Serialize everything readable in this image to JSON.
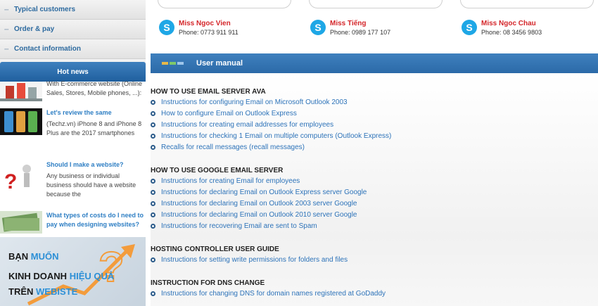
{
  "sidebar": {
    "nav": [
      {
        "label": "Typical customers"
      },
      {
        "label": "Order & pay"
      },
      {
        "label": "Contact information"
      }
    ],
    "hot_news": {
      "header": "Hot news",
      "items": [
        {
          "title": "",
          "text": "With E-commerce website (Online Sales, Stores, Mobile phones, ...):"
        },
        {
          "title": "Let's review the same",
          "text": "(Techz.vn) iPhone 8 and iPhone 8 Plus are the 2017 smartphones"
        },
        {
          "title": "Should I make a website?",
          "text": "Any business or individual business should have a website because the"
        },
        {
          "title": "What types of costs do I need to pay when designing websites?",
          "text": ""
        }
      ]
    },
    "banner": {
      "line1_a": "BẠN",
      "line1_b": "MUỐN",
      "line2_a": "KINH DOANH",
      "line2_b": "HIỆU QUẢ",
      "line3_a": "TRÊN",
      "line3_b": "WEBISTE",
      "mark": "?"
    }
  },
  "contacts": [
    {
      "name": "Miss Ngoc Vien",
      "phone": "Phone: 0773 911 911"
    },
    {
      "name": "Miss Tiếng",
      "phone": "Phone: 0989 177 107"
    },
    {
      "name": "Miss Ngoc Chau",
      "phone": "Phone: 08 3456 9803"
    }
  ],
  "manual": {
    "title": "User manual",
    "sections": [
      {
        "heading": "HOW TO USE EMAIL SERVER AVA",
        "links": [
          "Instructions for configuring Email on Microsoft Outlook 2003",
          "How to configure Email on Outlook Express",
          "Instructions for creating email addresses for employees",
          "Instructions for checking 1 Email on multiple computers (Outlook Express)",
          "Recalls for recall messages (recall messages)"
        ]
      },
      {
        "heading": "HOW TO USE GOOGLE EMAIL SERVER",
        "links": [
          "Instructions for creating Email for employees",
          "Instructions for declaring Email on Outlook Express server Google",
          "Instructions for declaring Email on Outlook 2003 server Google",
          "Instructions for declaring Email on Outlook 2010 server Google",
          "Instructions for recovering Email are sent to Spam"
        ]
      },
      {
        "heading": "HOSTING CONTROLLER USER GUIDE",
        "links": [
          "Instructions for setting write permissions for folders and files"
        ]
      },
      {
        "heading": "INSTRUCTION FOR DNS CHANGE",
        "links": [
          "Instructions for changing DNS for domain names registered at GoDaddy"
        ]
      }
    ]
  },
  "colors": {
    "accent_blue": "#2b6aa8",
    "link_blue": "#2d73b9",
    "contact_red": "#d4262a",
    "skype_blue": "#1ea7e6"
  },
  "icons": {
    "skype": "skype-icon",
    "bullet": "bullet-icon",
    "nav_dots": "dots-icon"
  }
}
